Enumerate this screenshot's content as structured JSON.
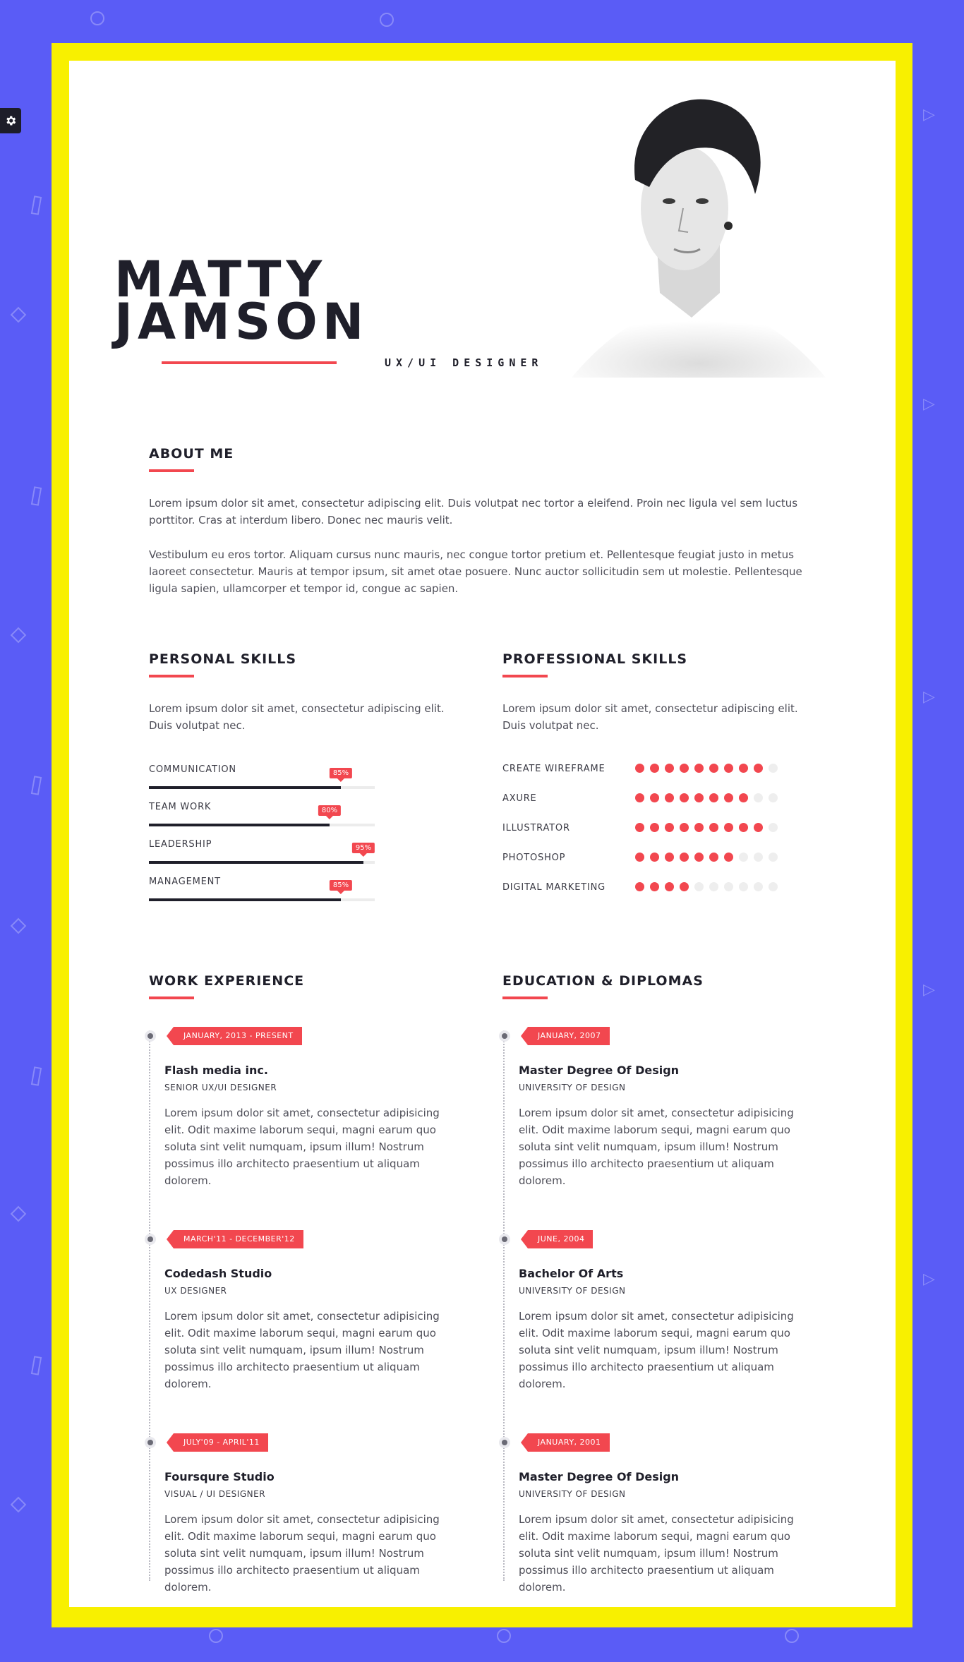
{
  "header": {
    "name_line1": "MATTY",
    "name_line2": "JAMSON",
    "job_title": "UX/UI DESIGNER"
  },
  "about": {
    "heading": "ABOUT ME",
    "paragraph1": "Lorem ipsum dolor sit amet, consectetur adipiscing elit. Duis volutpat nec tortor a eleifend. Proin nec ligula vel sem luctus porttitor. Cras at interdum libero. Donec nec mauris velit.",
    "paragraph2": "Vestibulum eu eros tortor. Aliquam cursus nunc mauris, nec congue tortor pretium et. Pellentesque feugiat justo in metus laoreet consectetur. Mauris at tempor ipsum, sit amet otae posuere. Nunc auctor sollicitudin sem ut molestie. Pellentesque ligula sapien, ullamcorper et tempor id, congue ac sapien."
  },
  "personal_skills": {
    "heading": "PERSONAL SKILLS",
    "intro": "Lorem ipsum dolor sit amet, consectetur adipiscing elit. Duis volutpat nec.",
    "items": [
      {
        "label": "COMMUNICATION",
        "percent_label": "85%",
        "level": 0.85
      },
      {
        "label": "TEAM WORK",
        "percent_label": "80%",
        "level": 0.8
      },
      {
        "label": "LEADERSHIP",
        "percent_label": "95%",
        "level": 0.95
      },
      {
        "label": "MANAGEMENT",
        "percent_label": "85%",
        "level": 0.85
      }
    ]
  },
  "professional_skills": {
    "heading": "PROFESSIONAL SKILLS",
    "intro": "Lorem ipsum dolor sit amet, consectetur adipiscing elit. Duis volutpat nec.",
    "max_dots": 10,
    "items": [
      {
        "label": "CREATE WIREFRAME",
        "filled": 9
      },
      {
        "label": "AXURE",
        "filled": 8
      },
      {
        "label": "ILLUSTRATOR",
        "filled": 9
      },
      {
        "label": "PHOTOSHOP",
        "filled": 7
      },
      {
        "label": "DIGITAL MARKETING",
        "filled": 4
      }
    ]
  },
  "work": {
    "heading": "WORK EXPERIENCE",
    "items": [
      {
        "date": "JANUARY, 2013 - PRESENT",
        "title": "Flash media inc.",
        "subtitle": "SENIOR UX/UI DESIGNER",
        "body": "Lorem ipsum dolor sit amet, consectetur adipisicing elit. Odit maxime laborum sequi, magni earum quo soluta sint velit numquam, ipsum illum! Nostrum possimus illo architecto praesentium ut aliquam dolorem."
      },
      {
        "date": "MARCH'11 - DECEMBER'12",
        "title": "Codedash Studio",
        "subtitle": "UX DESIGNER",
        "body": "Lorem ipsum dolor sit amet, consectetur adipisicing elit. Odit maxime laborum sequi, magni earum quo soluta sint velit numquam, ipsum illum! Nostrum possimus illo architecto praesentium ut aliquam dolorem."
      },
      {
        "date": "JULY'09 - APRIL'11",
        "title": "Foursqure Studio",
        "subtitle": "VISUAL / UI DESIGNER",
        "body": "Lorem ipsum dolor sit amet, consectetur adipisicing elit. Odit maxime laborum sequi, magni earum quo soluta sint velit numquam, ipsum illum! Nostrum possimus illo architecto praesentium ut aliquam dolorem."
      }
    ]
  },
  "education": {
    "heading": "EDUCATION & DIPLOMAS",
    "items": [
      {
        "date": "JANUARY, 2007",
        "title": "Master Degree Of Design",
        "subtitle": "UNIVERSITY OF DESIGN",
        "body": "Lorem ipsum dolor sit amet, consectetur adipisicing elit. Odit maxime laborum sequi, magni earum quo soluta sint velit numquam, ipsum illum! Nostrum possimus illo architecto praesentium ut aliquam dolorem."
      },
      {
        "date": "JUNE, 2004",
        "title": "Bachelor Of Arts",
        "subtitle": "UNIVERSITY OF DESIGN",
        "body": "Lorem ipsum dolor sit amet, consectetur adipisicing elit. Odit maxime laborum sequi, magni earum quo soluta sint velit numquam, ipsum illum! Nostrum possimus illo architecto praesentium ut aliquam dolorem."
      },
      {
        "date": "JANUARY, 2001",
        "title": "Master Degree Of Design",
        "subtitle": "UNIVERSITY OF DESIGN",
        "body": "Lorem ipsum dolor sit amet, consectetur adipisicing elit. Odit maxime laborum sequi, magni earum quo soluta sint velit numquam, ipsum illum! Nostrum possimus illo architecto praesentium ut aliquam dolorem."
      }
    ]
  },
  "colors": {
    "background": "#5a5cf6",
    "frame": "#f8f000",
    "accent": "#f2474f",
    "text_dark": "#1f1f2a"
  },
  "icons": {
    "settings": "gear-icon",
    "portrait": "avatar"
  }
}
